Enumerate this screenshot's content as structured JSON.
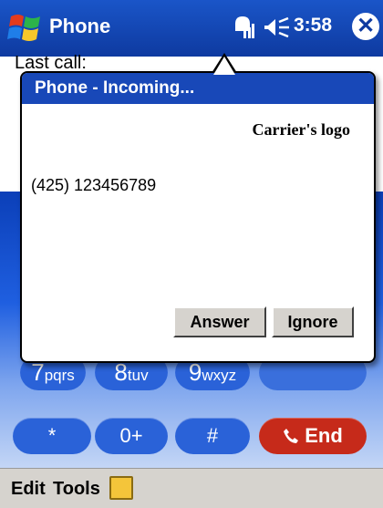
{
  "title_bar": {
    "app_title": "Phone",
    "time": "3:58",
    "close_glyph": "✕",
    "icons": [
      "windows-start-icon",
      "signal-icon",
      "speaker-icon",
      "close-icon"
    ]
  },
  "background": {
    "last_call_label": "Last call:",
    "keys": [
      {
        "digit": "7",
        "letters": "pqrs"
      },
      {
        "digit": "8",
        "letters": "tuv"
      },
      {
        "digit": "9",
        "letters": "wxyz"
      },
      {
        "digit": "*",
        "letters": ""
      },
      {
        "digit": "0+",
        "letters": ""
      },
      {
        "digit": "#",
        "letters": ""
      }
    ],
    "end_label": "End"
  },
  "dialog": {
    "title": "Phone - Incoming...",
    "carrier_logo_text": "Carrier's logo",
    "caller_number": "(425) 123456789",
    "answer_label": "Answer",
    "ignore_label": "Ignore"
  },
  "menu_bar": {
    "edit_label": "Edit",
    "tools_label": "Tools"
  },
  "colors": {
    "title_blue": "#1a55c8",
    "end_red": "#c62a1a",
    "menu_gray": "#d6d3ce"
  }
}
